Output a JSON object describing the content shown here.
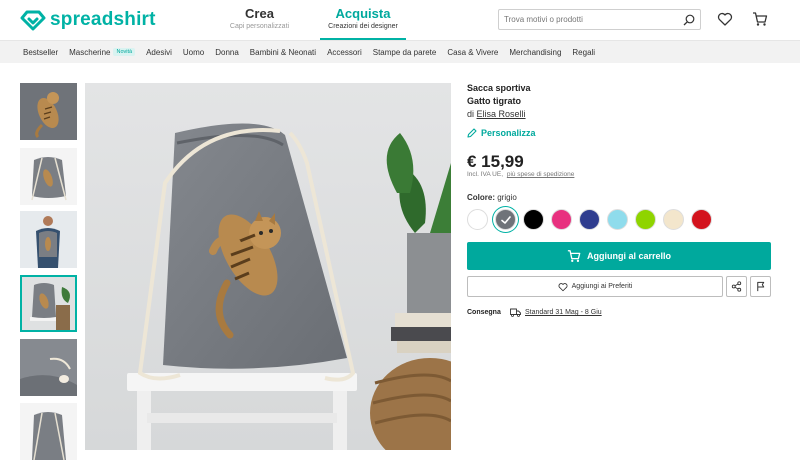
{
  "brand": {
    "name": "spreadshirt",
    "color": "#00b2a5"
  },
  "top_tabs": [
    {
      "title": "Crea",
      "subtitle": "Capi personalizzati"
    },
    {
      "title": "Acquista",
      "subtitle": "Creazioni dei designer",
      "active": true
    }
  ],
  "search": {
    "placeholder": "Trova motivi o prodotti",
    "value": ""
  },
  "header_icons": [
    "search-icon",
    "heart-icon",
    "cart-icon"
  ],
  "categories": [
    {
      "label": "Bestseller"
    },
    {
      "label": "Mascherine",
      "badge": "Novità"
    },
    {
      "label": "Adesivi"
    },
    {
      "label": "Uomo"
    },
    {
      "label": "Donna"
    },
    {
      "label": "Bambini & Neonati"
    },
    {
      "label": "Accessori"
    },
    {
      "label": "Stampe da parete"
    },
    {
      "label": "Casa & Vivere"
    },
    {
      "label": "Merchandising"
    },
    {
      "label": "Regali"
    }
  ],
  "product": {
    "type": "Sacca sportiva",
    "name": "Gatto tigrato",
    "by_prefix": "di",
    "designer": "Elisa Roselli",
    "personalize": "Personalizza",
    "price": "€ 15,99",
    "vat_text": "Incl. IVA UE,",
    "shipping_link": "più spese di spedizione",
    "color_label": "Colore:",
    "color_value": "grigio",
    "colors": [
      {
        "name": "bianco",
        "hex": "#ffffff"
      },
      {
        "name": "grigio",
        "hex": "#6f7379",
        "selected": true
      },
      {
        "name": "nero",
        "hex": "#000000"
      },
      {
        "name": "fucsia",
        "hex": "#e8317f"
      },
      {
        "name": "blu royal",
        "hex": "#2f3d8f"
      },
      {
        "name": "azzurro",
        "hex": "#8fdcec"
      },
      {
        "name": "verde lime",
        "hex": "#8fd400"
      },
      {
        "name": "naturale",
        "hex": "#f3e6cc"
      },
      {
        "name": "rosso",
        "hex": "#d3131d"
      }
    ],
    "add_to_cart": "Aggiungi al carrello",
    "add_to_favorites": "Aggiungi ai Preferiti",
    "delivery_label": "Consegna",
    "delivery_value": "Standard 31 Mag - 8 Giu"
  },
  "thumbnails": [
    {
      "name": "thumb-design"
    },
    {
      "name": "thumb-bag-front"
    },
    {
      "name": "thumb-model"
    },
    {
      "name": "thumb-bag-lifestyle",
      "selected": true
    },
    {
      "name": "thumb-bag-detail"
    },
    {
      "name": "thumb-bag-back"
    }
  ]
}
